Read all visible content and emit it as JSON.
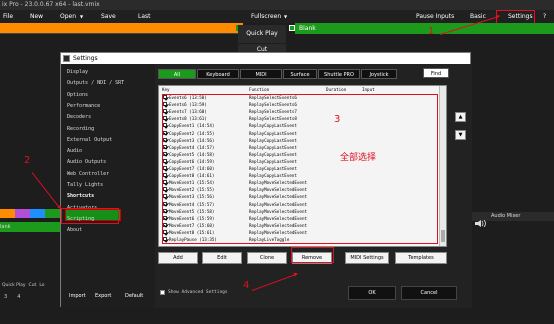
{
  "window": {
    "title": "ix Pro - 23.0.0.67 x64 - last.vmix"
  },
  "menubar": {
    "file": "File",
    "new": "New",
    "open": "Open",
    "open_arrow": "▼",
    "save": "Save",
    "last": "Last",
    "fullscreen": "Fullscreen",
    "fullscreen_arrow": "▼",
    "pause_inputs": "Pause Inputs",
    "basic": "Basic",
    "settings": "Settings",
    "help": "?"
  },
  "output": {
    "blank_label": "Blank",
    "quick_play": "Quick Play",
    "cut": "Cut"
  },
  "background": {
    "audio_mixer": "Audio Mixer",
    "bottom_tabs": [
      "Quick Play",
      "Cut",
      "Lo"
    ],
    "bottom_nums": [
      "3",
      "4"
    ],
    "left_label": "lank"
  },
  "dialog": {
    "title": "Settings",
    "sidebar": [
      "Display",
      "Outputs / NDI / SRT",
      "Options",
      "Performance",
      "Decoders",
      "Recording",
      "External Output",
      "Audio",
      "Audio Outputs",
      "Web Controller",
      "Tally Lights",
      "Shortcuts",
      "Activators",
      "Scripting",
      "About"
    ],
    "selected": "Shortcuts",
    "footer": {
      "import": "Import",
      "export": "Export",
      "default": "Default"
    },
    "tabs": [
      "All",
      "Keyboard",
      "MIDI",
      "Surface",
      "Shuttle PRO",
      "Joystick"
    ],
    "find": "Find",
    "columns": [
      "Key",
      "Function",
      "Duration",
      "Input"
    ],
    "rows": [
      {
        "key": "Events6 (13:58)",
        "function": "ReplaySelectEvents6"
      },
      {
        "key": "Events6 (13:59)",
        "function": "ReplaySelectEvents6"
      },
      {
        "key": "Events7 (13:60)",
        "function": "ReplaySelectEvents7"
      },
      {
        "key": "Events8 (13:61)",
        "function": "ReplaySelectEvents8"
      },
      {
        "key": "CopyEvent1 (14:54)",
        "function": "ReplayCopyLastEvent"
      },
      {
        "key": "CopyEvent2 (14:55)",
        "function": "ReplayCopyLastEvent"
      },
      {
        "key": "CopyEvent3 (14:56)",
        "function": "ReplayCopyLastEvent"
      },
      {
        "key": "CopyEvent4 (14:57)",
        "function": "ReplayCopyLastEvent"
      },
      {
        "key": "CopyEvent5 (14:58)",
        "function": "ReplayCopyLastEvent"
      },
      {
        "key": "CopyEvent6 (14:59)",
        "function": "ReplayCopyLastEvent"
      },
      {
        "key": "CopyEvent7 (14:60)",
        "function": "ReplayCopyLastEvent"
      },
      {
        "key": "CopyEvent8 (14:61)",
        "function": "ReplayCopyLastEvent"
      },
      {
        "key": "MoveEvent1 (15:54)",
        "function": "ReplayMoveSelectedEvent"
      },
      {
        "key": "MoveEvent2 (15:55)",
        "function": "ReplayMoveSelectedEvent"
      },
      {
        "key": "MoveEvent3 (15:56)",
        "function": "ReplayMoveSelectedEvent"
      },
      {
        "key": "MoveEvent4 (15:57)",
        "function": "ReplayMoveSelectedEvent"
      },
      {
        "key": "MoveEvent5 (15:58)",
        "function": "ReplayMoveSelectedEvent"
      },
      {
        "key": "MoveEvent6 (15:59)",
        "function": "ReplayMoveSelectedEvent"
      },
      {
        "key": "MoveEvent7 (15:60)",
        "function": "ReplayMoveSelectedEvent"
      },
      {
        "key": "MoveEvent8 (15:61)",
        "function": "ReplayMoveSelectedEvent"
      },
      {
        "key": "ReplayPause (13:35)",
        "function": "ReplayLiveToggle"
      }
    ],
    "buttons": {
      "add": "Add",
      "edit": "Edit",
      "clone": "Clone",
      "remove": "Remove",
      "midi_settings": "MIDI Settings",
      "templates": "Templates"
    },
    "show_advanced": "Show Advanced Settings",
    "ok": "OK",
    "cancel": "Cancel"
  },
  "annotations": {
    "n1": "1",
    "n2": "2",
    "n3": "3",
    "n4": "4",
    "select_all": "全部选择"
  },
  "colors": {
    "accent_green": "#1b9a1b",
    "accent_orange": "#ff8c00",
    "annotation_red": "#e01020"
  }
}
